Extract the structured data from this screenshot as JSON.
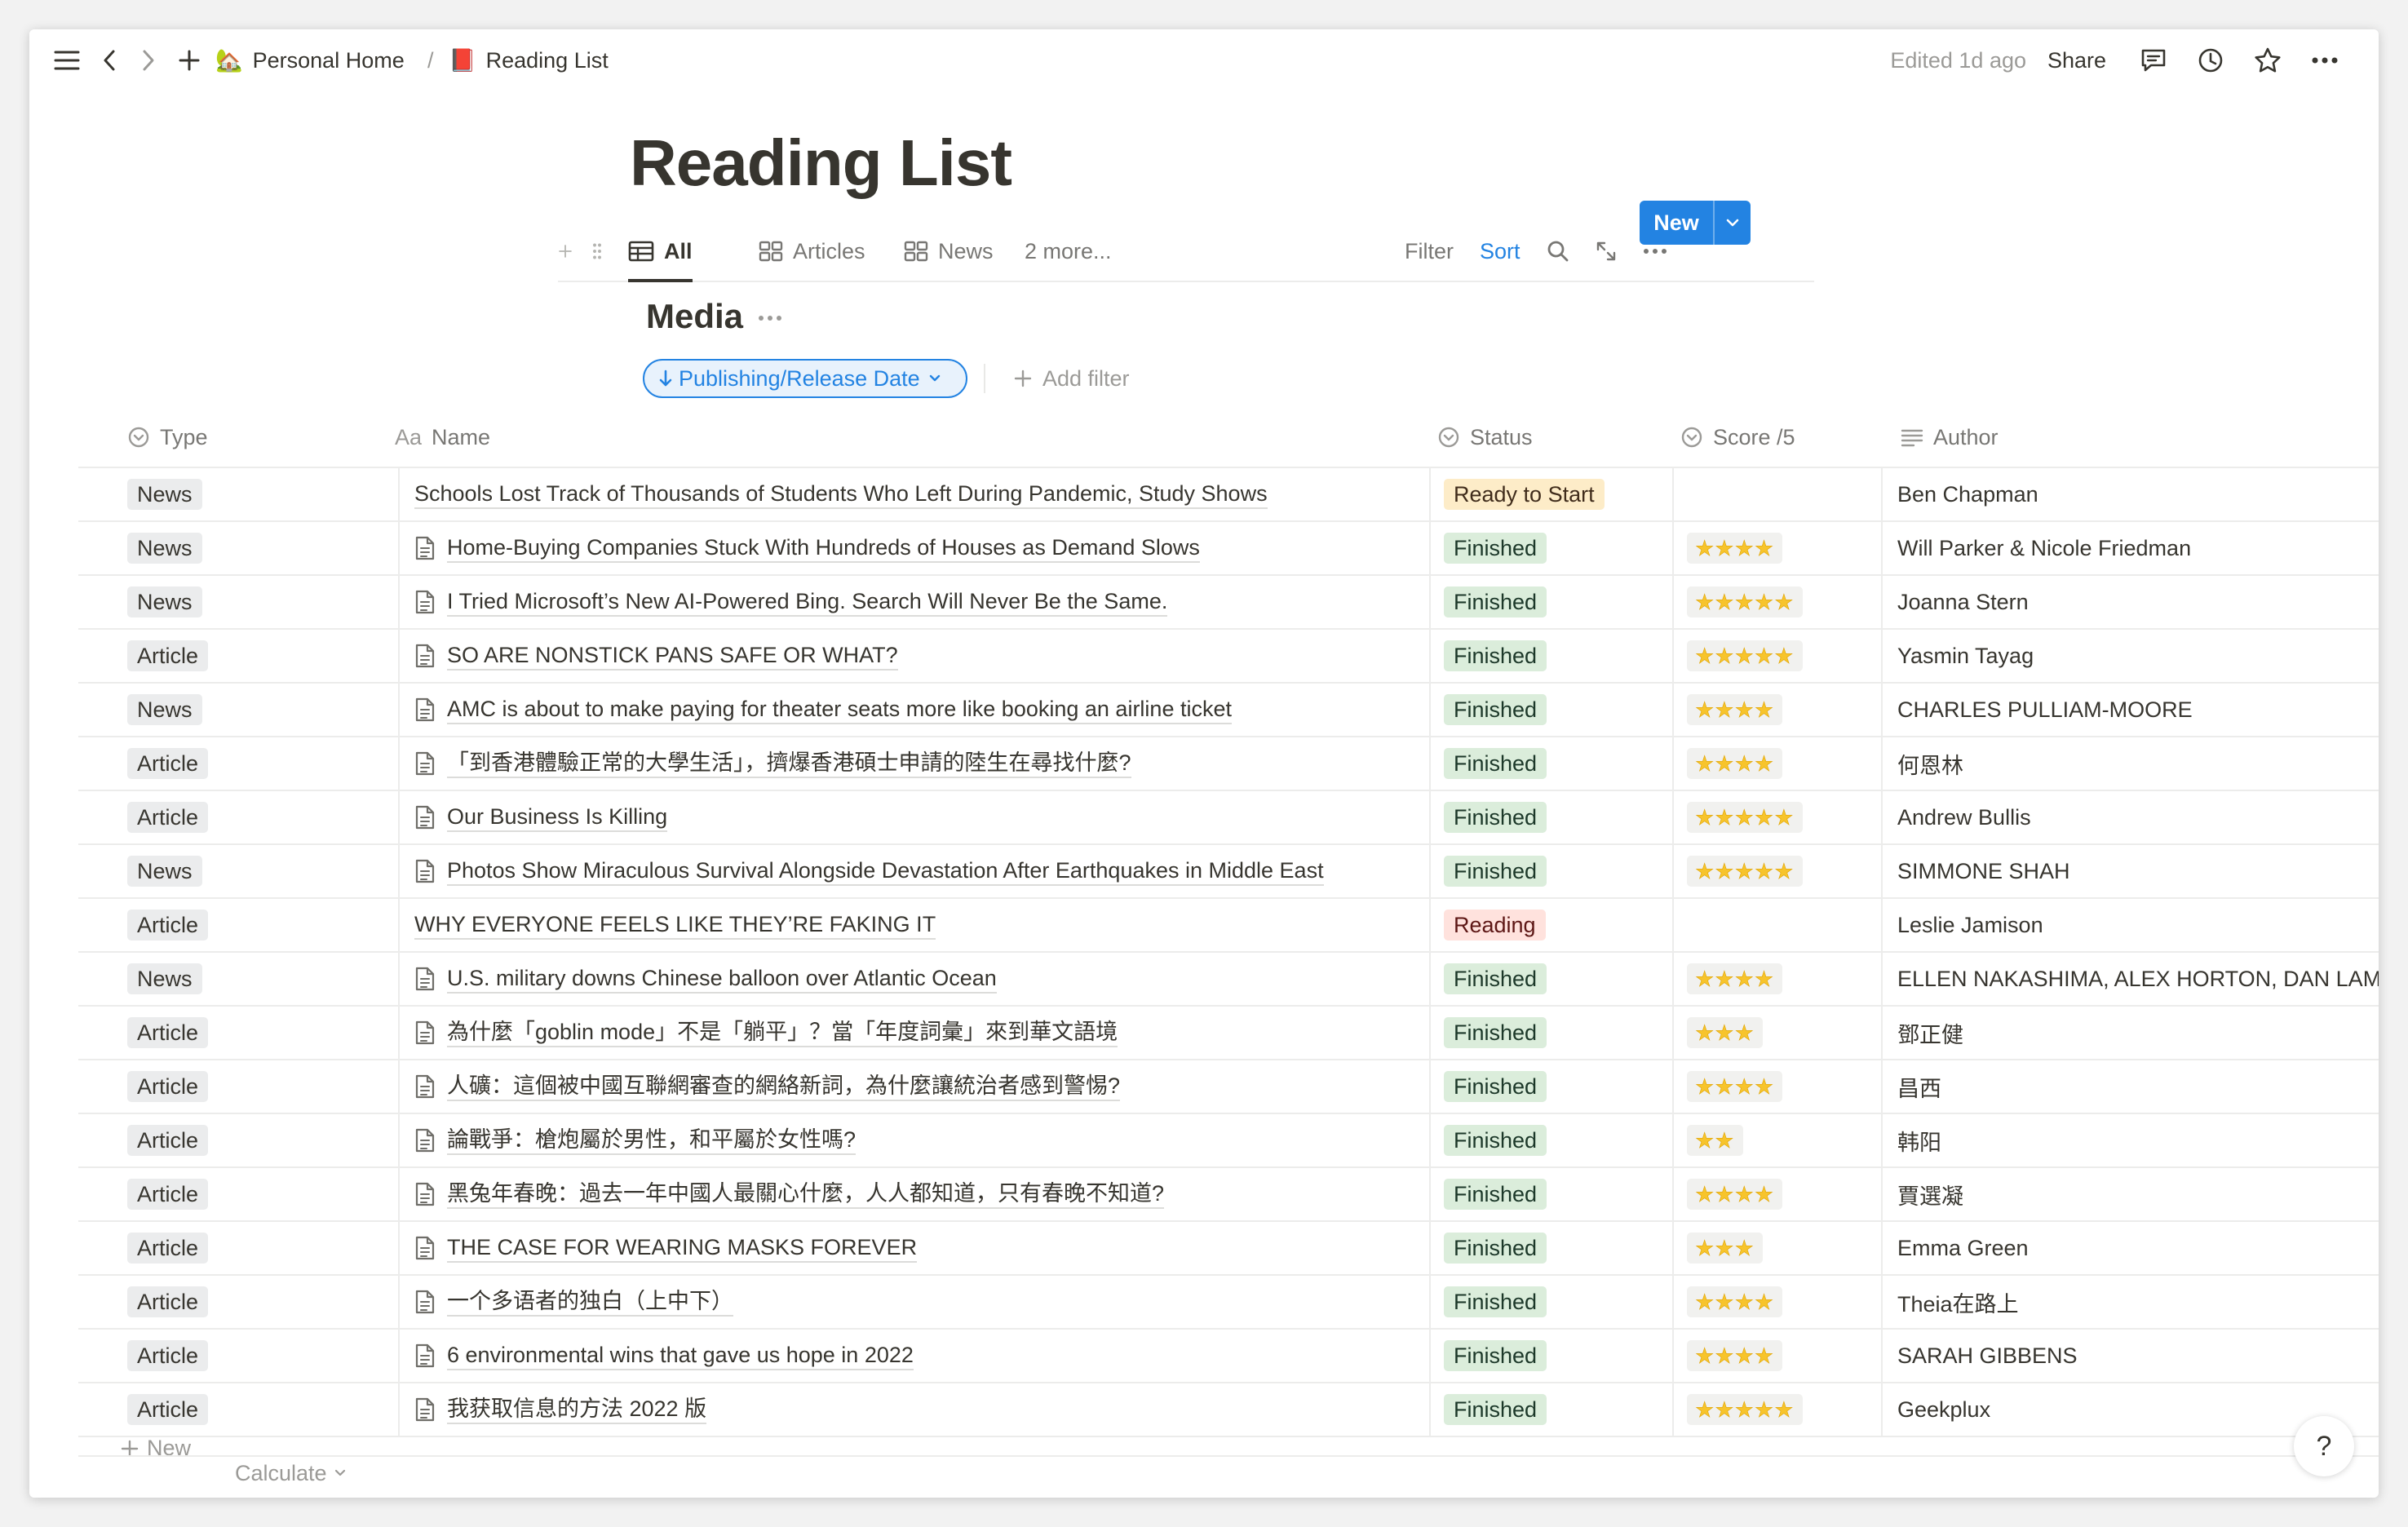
{
  "breadcrumb": {
    "home_emoji": "🏡",
    "home_label": "Personal Home",
    "separator": "/",
    "page_emoji": "📕",
    "page_label": "Reading List"
  },
  "topbar": {
    "edited": "Edited 1d ago",
    "share": "Share"
  },
  "page": {
    "title": "Reading List"
  },
  "views": {
    "tabs": [
      {
        "label": "All",
        "icon": "table-icon"
      },
      {
        "label": "Articles",
        "icon": "gallery-icon"
      },
      {
        "label": "News",
        "icon": "gallery-icon"
      }
    ],
    "more": "2 more...",
    "filter": "Filter",
    "sort": "Sort",
    "new": "New"
  },
  "database": {
    "title": "Media",
    "sort_chip": "Publishing/Release Date",
    "add_filter": "Add filter"
  },
  "columns": {
    "type": "Type",
    "name_prefix": "Aa",
    "name": "Name",
    "status": "Status",
    "score": "Score /5",
    "author": "Author"
  },
  "rows": [
    {
      "type": "News",
      "name": "Schools Lost Track of Thousands of Students Who Left During Pandemic, Study Shows",
      "doc": false,
      "status": "Ready to Start",
      "stars": 0,
      "author": "Ben Chapman"
    },
    {
      "type": "News",
      "name": "Home-Buying Companies Stuck With Hundreds of Houses as Demand Slows",
      "doc": true,
      "status": "Finished",
      "stars": 4,
      "author": "Will Parker & Nicole Friedman"
    },
    {
      "type": "News",
      "name": "I Tried Microsoft’s New AI-Powered Bing. Search Will Never Be the Same.",
      "doc": true,
      "status": "Finished",
      "stars": 5,
      "author": "Joanna Stern"
    },
    {
      "type": "Article",
      "name": "SO ARE NONSTICK PANS SAFE OR WHAT?",
      "doc": true,
      "status": "Finished",
      "stars": 5,
      "author": "Yasmin Tayag"
    },
    {
      "type": "News",
      "name": "AMC is about to make paying for theater seats more like booking an airline ticket",
      "doc": true,
      "status": "Finished",
      "stars": 4,
      "author": "CHARLES PULLIAM-MOORE"
    },
    {
      "type": "Article",
      "name": "「到香港體驗正常的大學生活」，擠爆香港碩士申請的陸生在尋找什麼?",
      "doc": true,
      "status": "Finished",
      "stars": 4,
      "author": "何恩林"
    },
    {
      "type": "Article",
      "name": "Our Business Is Killing",
      "doc": true,
      "status": "Finished",
      "stars": 5,
      "author": "Andrew Bullis"
    },
    {
      "type": "News",
      "name": "Photos Show Miraculous Survival Alongside Devastation After Earthquakes in Middle East",
      "doc": true,
      "status": "Finished",
      "stars": 5,
      "author": "SIMMONE SHAH"
    },
    {
      "type": "Article",
      "name": "WHY EVERYONE FEELS LIKE THEY’RE FAKING IT",
      "doc": false,
      "status": "Reading",
      "stars": 0,
      "author": "Leslie Jamison"
    },
    {
      "type": "News",
      "name": "U.S. military downs Chinese balloon over Atlantic Ocean",
      "doc": true,
      "status": "Finished",
      "stars": 4,
      "author": "ELLEN NAKASHIMA, ALEX HORTON, DAN LAMOTHE"
    },
    {
      "type": "Article",
      "name": "為什麼「goblin mode」不是「躺平」？當「年度詞彙」來到華文語境",
      "doc": true,
      "status": "Finished",
      "stars": 3,
      "author": "鄧正健"
    },
    {
      "type": "Article",
      "name": "人礦：這個被中國互聯網審查的網絡新詞，為什麼讓統治者感到警惕?",
      "doc": true,
      "status": "Finished",
      "stars": 4,
      "author": "昌西"
    },
    {
      "type": "Article",
      "name": "論戰爭：槍炮屬於男性，和平屬於女性嗎?",
      "doc": true,
      "status": "Finished",
      "stars": 2,
      "author": "韩阳"
    },
    {
      "type": "Article",
      "name": "黑兔年春晚：過去一年中國人最關心什麼，人人都知道，只有春晚不知道?",
      "doc": true,
      "status": "Finished",
      "stars": 4,
      "author": "賈選凝"
    },
    {
      "type": "Article",
      "name": "THE CASE FOR WEARING MASKS FOREVER",
      "doc": true,
      "status": "Finished",
      "stars": 3,
      "author": "Emma Green"
    },
    {
      "type": "Article",
      "name": "一个多语者的独白（上中下）",
      "doc": true,
      "status": "Finished",
      "stars": 4,
      "author": "Theia在路上"
    },
    {
      "type": "Article",
      "name": "6 environmental wins that gave us hope in 2022",
      "doc": true,
      "status": "Finished",
      "stars": 4,
      "author": "SARAH GIBBENS"
    },
    {
      "type": "Article",
      "name": "我获取信息的方法 2022 版",
      "doc": true,
      "status": "Finished",
      "stars": 5,
      "author": "Geekplux"
    }
  ],
  "footer": {
    "new_row": "New",
    "calculate": "Calculate",
    "help": "?"
  },
  "colors": {
    "accent": "#2383e2",
    "finished_bg": "#dbeddb",
    "ready_bg": "#fdecc8",
    "reading_bg": "#ffe2dd",
    "star": "#f7c42c"
  }
}
